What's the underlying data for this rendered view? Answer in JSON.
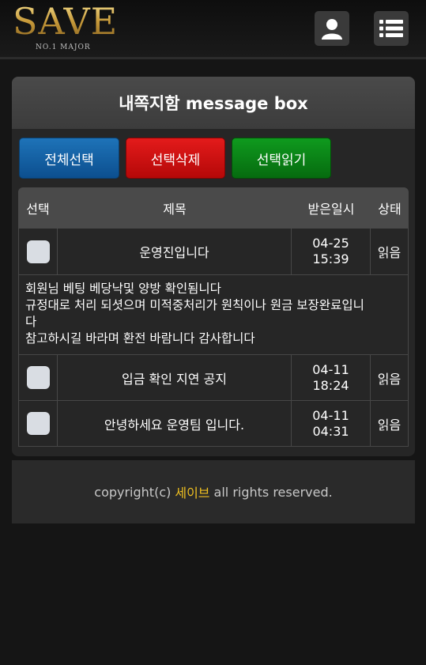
{
  "header": {
    "logo_text": "SAVE",
    "logo_sub": "NO.1 MAJOR",
    "user_icon": "user-icon",
    "menu_icon": "list-menu-icon"
  },
  "panel": {
    "title": "내쪽지함 message box"
  },
  "actions": {
    "select_all": "전체선택",
    "delete_selected": "선택삭제",
    "read_selected": "선택읽기"
  },
  "table": {
    "headers": {
      "select": "선택",
      "title": "제목",
      "received": "받은일시",
      "status": "상태"
    },
    "rows": [
      {
        "title": "운영진입니다",
        "date": "04-25",
        "time": "15:39",
        "status": "읽음"
      },
      {
        "title": "입금 확인 지연 공지",
        "date": "04-11",
        "time": "18:24",
        "status": "읽음"
      },
      {
        "title": "안녕하세요 운영팀 입니다.",
        "date": "04-11",
        "time": "04:31",
        "status": "읽음"
      }
    ],
    "message_lines": [
      "회원님 베팅 베당낙및 양방 확인됨니다",
      "규정대로 처리 되셧으며 미적중처리가 원칙이나 원금 보장완료입니",
      "다",
      "참고하시길 바라며 환전 바람니다 감사합니다"
    ]
  },
  "footer": {
    "prefix": "copyright(c)",
    "brand": "세이브",
    "suffix": "all rights reserved."
  },
  "colors": {
    "brand_gold": "#c9a246",
    "footer_brand": "#f0c020",
    "btn_blue": "#1e73b8",
    "btn_red": "#e31b1b",
    "btn_green": "#0f9a1e"
  }
}
